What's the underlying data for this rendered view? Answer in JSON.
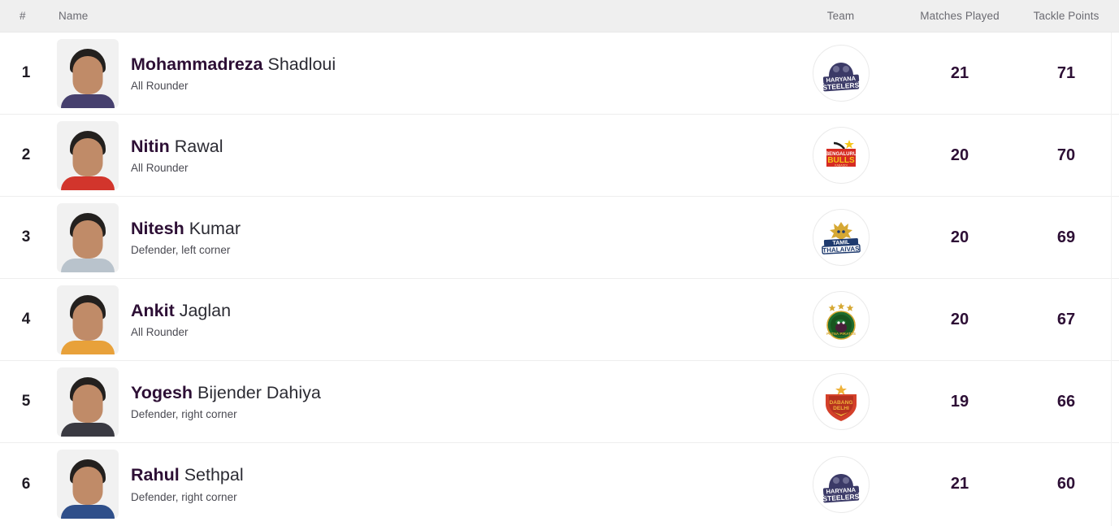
{
  "table": {
    "columns": {
      "rank": "#",
      "name": "Name",
      "team": "Team",
      "matches": "Matches Played",
      "points": "Tackle Points"
    },
    "rows": [
      {
        "rank": "1",
        "first_name": "Mohammadreza",
        "last_name": "Shadloui",
        "role": "All Rounder",
        "team_name": "Haryana Steelers",
        "team_logo": "haryana-steelers-logo",
        "matches_played": "21",
        "tackle_points": "71",
        "jersey_color": "#46406e",
        "logo_primary": "#3b3a67",
        "logo_secondary": "#ffffff"
      },
      {
        "rank": "2",
        "first_name": "Nitin",
        "last_name": "Rawal",
        "role": "All Rounder",
        "team_name": "Bengaluru Bulls",
        "team_logo": "bengaluru-bulls-logo",
        "matches_played": "20",
        "tackle_points": "70",
        "jersey_color": "#d2352c",
        "logo_primary": "#d62b22",
        "logo_secondary": "#f5c518"
      },
      {
        "rank": "3",
        "first_name": "Nitesh",
        "last_name": "Kumar",
        "role": "Defender, left corner",
        "team_name": "Tamil Thalaivas",
        "team_logo": "tamil-thalaivas-logo",
        "matches_played": "20",
        "tackle_points": "69",
        "jersey_color": "#b9c3cc",
        "logo_primary": "#1e3a6e",
        "logo_secondary": "#d6a833"
      },
      {
        "rank": "4",
        "first_name": "Ankit",
        "last_name": "Jaglan",
        "role": "All Rounder",
        "team_name": "Patna Pirates",
        "team_logo": "patna-pirates-logo",
        "matches_played": "20",
        "tackle_points": "67",
        "jersey_color": "#e8a13a",
        "logo_primary": "#1d6b2e",
        "logo_secondary": "#d6a833"
      },
      {
        "rank": "5",
        "first_name": "Yogesh",
        "last_name": "Bijender Dahiya",
        "role": "Defender, right corner",
        "team_name": "Dabang Delhi",
        "team_logo": "dabang-delhi-logo",
        "matches_played": "19",
        "tackle_points": "66",
        "jersey_color": "#3a3a42",
        "logo_primary": "#d4402a",
        "logo_secondary": "#efb23a"
      },
      {
        "rank": "6",
        "first_name": "Rahul",
        "last_name": "Sethpal",
        "role": "Defender, right corner",
        "team_name": "Haryana Steelers",
        "team_logo": "haryana-steelers-logo",
        "matches_played": "21",
        "tackle_points": "60",
        "jersey_color": "#2f4f8a",
        "logo_primary": "#3b3a67",
        "logo_secondary": "#ffffff"
      }
    ]
  }
}
